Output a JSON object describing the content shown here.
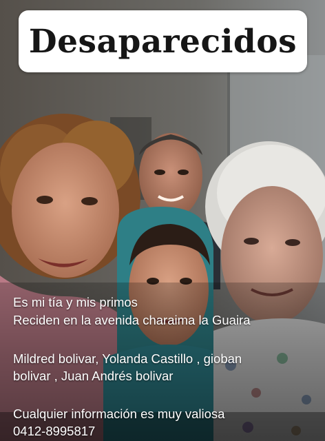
{
  "title": "Desaparecidos",
  "caption": {
    "line1": "Es mi tía y mis primos",
    "line2": "Reciden en la avenida charaima la Guaira",
    "line3": "Mildred bolivar, Yolanda Castillo , gioban",
    "line4": "bolivar , Juan Andrés bolivar",
    "line5": "Cualquier información es muy valiosa",
    "line6": "0412-8995817"
  },
  "colors": {
    "title_bg": "#ffffff",
    "title_text": "#161616",
    "caption_text": "#ffffff"
  }
}
